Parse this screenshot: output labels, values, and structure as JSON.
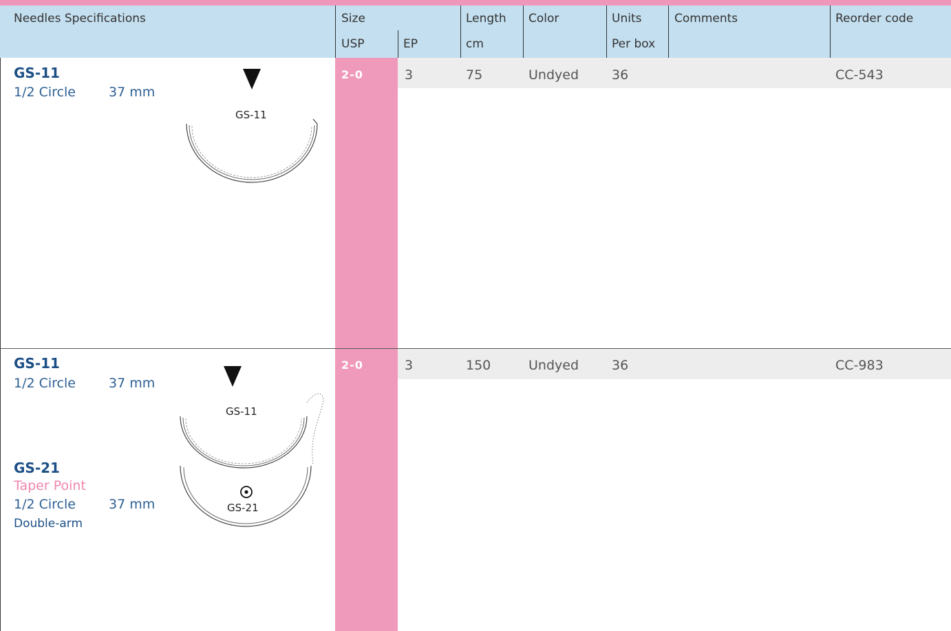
{
  "header": {
    "needles_spec": "Needles Specifications",
    "size": "Size",
    "usp": "USP",
    "ep": "EP",
    "length": "Length",
    "length_unit": "cm",
    "color": "Color",
    "units": "Units",
    "units_sub": "Per box",
    "comments": "Comments",
    "reorder": "Reorder code"
  },
  "rows": [
    {
      "needle_code": "GS-11",
      "shape": "1/2 Circle",
      "length_mm": "37 mm",
      "image_label": "GS-11",
      "usp": "2-0",
      "ep": "3",
      "length_cm": "75",
      "color": "Undyed",
      "units": "36",
      "comments": "",
      "reorder": "CC-543"
    },
    {
      "needle_code": "GS-11",
      "shape": "1/2 Circle",
      "length_mm": "37 mm",
      "image_label": "GS-11",
      "second_code": "GS-21",
      "second_point": "Taper Point",
      "second_shape": "1/2 Circle",
      "second_length_mm": "37 mm",
      "second_image_label": "GS-21",
      "arm": "Double-arm",
      "usp": "2-0",
      "ep": "3",
      "length_cm": "150",
      "color": "Undyed",
      "units": "36",
      "comments": "",
      "reorder": "CC-983"
    }
  ],
  "colors": {
    "accent_pink": "#f09abb",
    "header_blue": "#c4dfef",
    "code_blue": "#1c4f86",
    "row_gray": "#ededed"
  },
  "icons": {
    "cutting_point": "triangle-down-icon",
    "taper_point": "circle-dot-icon"
  }
}
